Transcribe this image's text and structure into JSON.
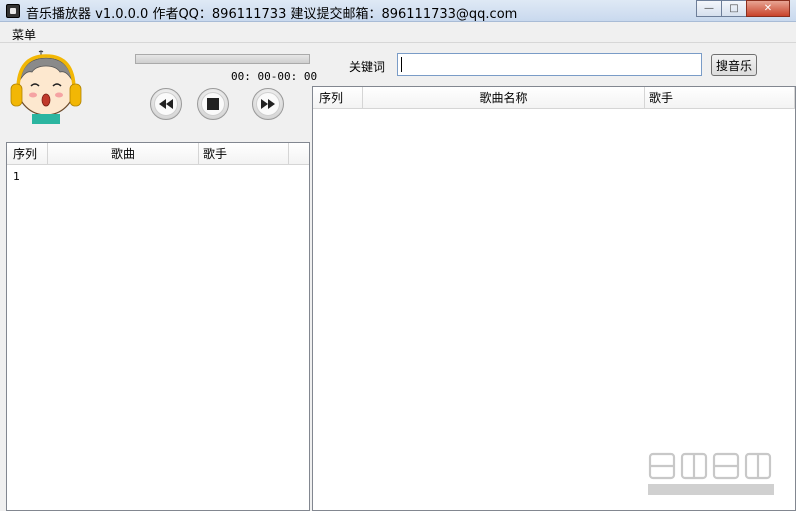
{
  "window": {
    "title": "音乐播放器 v1.0.0.0   作者QQ：896111733 建议提交邮箱：896111733@qq.com",
    "minimize": "—",
    "maximize": "□",
    "close": "✕"
  },
  "menu": {
    "items": [
      {
        "label": "菜单"
      }
    ]
  },
  "player": {
    "time": "00: 00-00: 00",
    "progress": 0,
    "controls": [
      "rewind-icon",
      "stop-icon",
      "fast-forward-icon"
    ]
  },
  "playlist": {
    "columns": [
      "序列",
      "歌曲",
      "歌手"
    ],
    "rows": [
      {
        "index": "1",
        "song": "",
        "artist": ""
      }
    ]
  },
  "search": {
    "label": "关键词",
    "value": "",
    "button": "搜音乐"
  },
  "results": {
    "columns": [
      "序列",
      "歌曲名称",
      "歌手"
    ],
    "rows": []
  },
  "watermark": {
    "text": "绿色先锋",
    "url": "www.greenxf.com"
  },
  "colors": {
    "avatar_skin": "#fde8cf",
    "headphones": "#f2b705",
    "shirt": "#2bb5a0"
  }
}
